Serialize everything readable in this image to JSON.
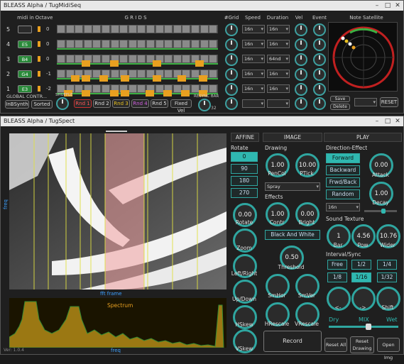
{
  "top_window": {
    "title": "BLEASS Alpha / TugMidiSeq",
    "headers": {
      "midi_in": "midi in",
      "octave": "Octave",
      "grids": "G R I D S",
      "grid_count": "#Grid",
      "speed": "Speed",
      "duration": "Duration",
      "vel": "Vel",
      "event": "Event",
      "note_satellite": "Note Satellite"
    },
    "rows": [
      {
        "num": "5",
        "note": "",
        "octave": "0",
        "speed": "16n",
        "duration": "16n",
        "grid_val": "5"
      },
      {
        "num": "4",
        "note": "E5",
        "octave": "0",
        "speed": "16n",
        "duration": "16n",
        "grid_val": "4"
      },
      {
        "num": "3",
        "note": "B4",
        "octave": "0",
        "speed": "16n",
        "duration": "64nd",
        "grid_val": "3"
      },
      {
        "num": "2",
        "note": "G4",
        "octave": "-1",
        "speed": "16n",
        "duration": "16n",
        "grid_val": "2"
      },
      {
        "num": "1",
        "note": "E3",
        "octave": "-2",
        "speed": "16n",
        "duration": "16n",
        "grid_val": "1"
      }
    ],
    "global_controls": "GLOBAL CONTR...",
    "in_synth": "InBSynth",
    "sorted": "Sorted",
    "shuffle": "SHUFFLE",
    "rnd_buttons": [
      "Rnd 1",
      "Rnd 2",
      "Rnd 3",
      "Rnd 4",
      "Rnd 5"
    ],
    "fixed_vel": "Fixed Vel",
    "resync_bar": "RESYNC BAR",
    "resync_val": "32",
    "save": "Save",
    "delete": "Delete",
    "reset": "RESET",
    "colors": {
      "note_orange": "#e8a020",
      "accent_teal": "#3da0a0"
    }
  },
  "bottom_window": {
    "title": "BLEASS Alpha / TugSpect",
    "version": "Ver: 1.0.4",
    "freq_label": "freq",
    "fft_frame": "fft frame",
    "spectrum_label": "Spectrum",
    "affine": {
      "head": "AFFINE",
      "rotate_head": "Rotate",
      "rotate_options": [
        "0",
        "90",
        "180",
        "270"
      ],
      "rotate_selected": "0",
      "knobs": [
        {
          "label": "Rotate",
          "value": "0.00"
        },
        {
          "label": "Zoom",
          "value": ""
        },
        {
          "label": "Left/Right",
          "value": ""
        },
        {
          "label": "Up/Down",
          "value": ""
        },
        {
          "label": "HSkew",
          "value": ""
        },
        {
          "label": "VSkew",
          "value": ""
        }
      ]
    },
    "image": {
      "head": "IMAGE",
      "drawing": "Drawing",
      "pen_col": {
        "label": "PenCol",
        "value": "1.00"
      },
      "p_tick": {
        "label": "PTick",
        "value": "10.00"
      },
      "spray": "Spray",
      "effects": "Effects",
      "contr": {
        "label": "Contr",
        "value": "1.00"
      },
      "bright": {
        "label": "Bright",
        "value": "0.00"
      },
      "black_and_white": "Black And White",
      "threshold": {
        "label": "Threshold",
        "value": "0.50"
      },
      "sm_hor": "SmHor",
      "sm_ver": "SmVer",
      "h_rescale": "HRescale",
      "v_rescale": "VRescale",
      "record": "Record"
    },
    "play": {
      "head": "PLAY",
      "direction_effect": "Direction-Effect",
      "directions": [
        "Forward",
        "Backward",
        "Frwd/Back",
        "Random"
      ],
      "direction_selected": "Forward",
      "attack": {
        "label": "Attack",
        "value": "0.00"
      },
      "decay": {
        "label": "Decay",
        "value": "1.00"
      },
      "dir_select": "16n",
      "sound_texture": "Sound Texture",
      "bar": {
        "label": "Bar",
        "value": "1"
      },
      "pow": {
        "label": "Pow",
        "value": "4.56"
      },
      "wider": {
        "label": "Wider",
        "value": "10.76"
      },
      "interval_sync": "Interval/Sync",
      "sync_options": [
        "Free",
        "1/2",
        "1/4",
        "1/8",
        "1/16",
        "1/32"
      ],
      "sync_selected": "1/16",
      "lt": "<-",
      "gt": "->",
      "shift": "Shift",
      "dry": "Dry",
      "mix": "MIX",
      "wet": "Wet",
      "reset_all": "Reset All",
      "reset_drawing": "Reset Drawing",
      "open_img": "Open Img"
    }
  }
}
